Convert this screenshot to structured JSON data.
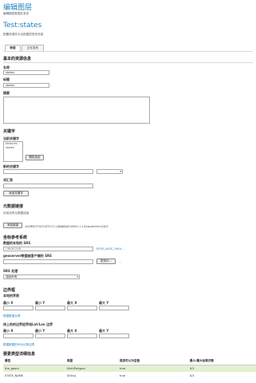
{
  "header": {
    "page_title": "编辑图层",
    "page_subtitle": "编辑图层数据并发布",
    "layer_name": "Test:states",
    "layer_desc": "配置资源并为当前图层发布信息"
  },
  "tabs": [
    {
      "label": "数据",
      "active": true
    },
    {
      "label": "正在发布",
      "active": false
    }
  ],
  "basic": {
    "section_title": "基本的资源信息",
    "name_label": "名称",
    "name_value": "states",
    "title_label": "标题",
    "title_value": "states",
    "abstract_label": "摘要"
  },
  "keywords": {
    "section_title": "关键字",
    "current_label": "当前关键字",
    "current_items": [
      "features",
      "states"
    ],
    "remove_button": "删除选定",
    "new_label": "新的关键字",
    "vocab_label": "词汇表",
    "add_button": "添加关键字"
  },
  "metadata_links": {
    "section_title": "元数据链接",
    "empty_text": "目前还有元数据连接",
    "add_button": "添加链接",
    "note": "请注意现在FGDC和TC211元数据链接在WMS1.1.1的capabilities中显示"
  },
  "crs": {
    "section_title": "坐标参考系统",
    "native_label": "数据的本地的 SRS",
    "native_value": "UNKNOWN",
    "native_link": "EPSG_WGS_1984...",
    "declared_label": "geoserver数据被客户端的 SRS",
    "find_button": "查找中...",
    "dots": "...",
    "handling_label": "SRS 处理",
    "handling_value": "强制声明"
  },
  "bbox": {
    "section_title": "边界框",
    "native_label": "本地的界限",
    "cols": [
      "最小 X",
      "最小 Y",
      "最大 X",
      "最大 Y"
    ],
    "compute_data_link": "根据数据计算",
    "latlon_label": "纬上的的边界经界线Lat/Lon 边界",
    "compute_native_link": "根据数据的SRS计算边界"
  },
  "feature_type": {
    "section_title": "要素类型详细信息",
    "headers": [
      "属性",
      "类型",
      "是否可以为空值",
      "最小/最大出现次数"
    ],
    "rows": [
      {
        "attr": "the_geom",
        "type": "MultiPolygon",
        "nillable": "true",
        "occurs": "0/1"
      },
      {
        "attr": "STATE_NAME",
        "type": "String",
        "nillable": "true",
        "occurs": "0/1"
      }
    ]
  },
  "colors": {
    "accent": "#1f7ec1",
    "selected_row": "#e3f0d0"
  }
}
